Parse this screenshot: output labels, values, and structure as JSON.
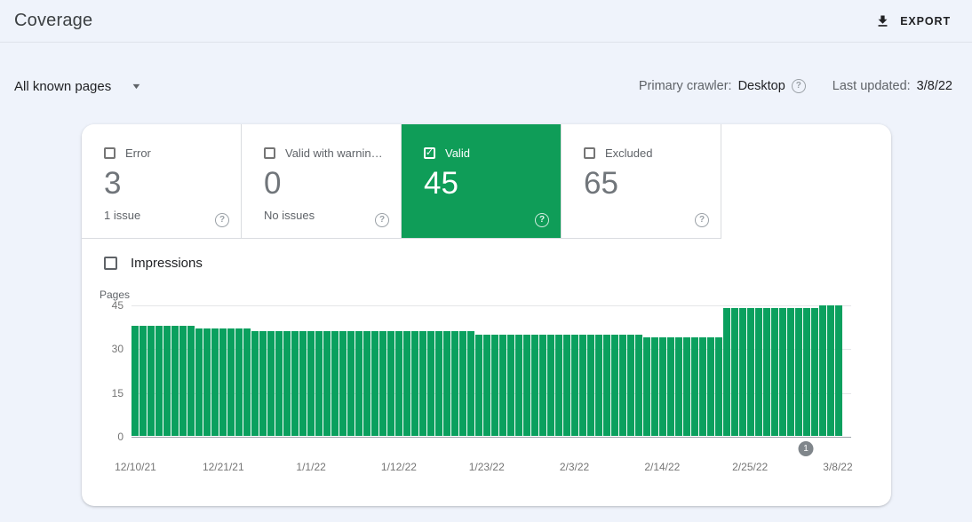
{
  "header": {
    "title": "Coverage",
    "export_label": "EXPORT"
  },
  "filter_bar": {
    "page_filter": "All known pages",
    "primary_crawler_label": "Primary crawler:",
    "primary_crawler_value": "Desktop",
    "last_updated_label": "Last updated:",
    "last_updated_value": "3/8/22"
  },
  "status_tiles": [
    {
      "label": "Error",
      "count": "3",
      "sub": "1 issue",
      "selected": false
    },
    {
      "label": "Valid with warnin…",
      "count": "0",
      "sub": "No issues",
      "selected": false
    },
    {
      "label": "Valid",
      "count": "45",
      "sub": "",
      "selected": true
    },
    {
      "label": "Excluded",
      "count": "65",
      "sub": "",
      "selected": false
    }
  ],
  "impressions_label": "Impressions",
  "icons": {
    "help": "?",
    "caret": "▼",
    "check": "✓"
  },
  "colors": {
    "selected_tile_green": "#0f9d58",
    "bar_green": "#0aa05e",
    "page_background": "#eff3fb",
    "marker_gray": "#80868b"
  },
  "chart_data": {
    "type": "bar",
    "title": "",
    "xlabel": "",
    "ylabel": "Pages",
    "ylim": [
      0,
      45
    ],
    "yticks": [
      45,
      30,
      15,
      0
    ],
    "grid": true,
    "x_unit": "day",
    "x_start": "12/10/21",
    "x_end": "3/8/22",
    "xtick_labels": [
      "12/10/21",
      "12/21/21",
      "1/1/22",
      "1/12/22",
      "1/23/22",
      "2/3/22",
      "2/14/22",
      "2/25/22",
      "3/8/22"
    ],
    "xtick_indices": [
      0,
      11,
      22,
      33,
      44,
      55,
      66,
      77,
      88
    ],
    "series": [
      {
        "name": "Valid pages",
        "values": [
          38,
          38,
          38,
          38,
          38,
          38,
          38,
          38,
          37,
          37,
          37,
          37,
          37,
          37,
          37,
          36,
          36,
          36,
          36,
          36,
          36,
          36,
          36,
          36,
          36,
          36,
          36,
          36,
          36,
          36,
          36,
          36,
          36,
          36,
          36,
          36,
          36,
          36,
          36,
          36,
          36,
          36,
          36,
          35,
          35,
          35,
          35,
          35,
          35,
          35,
          35,
          35,
          35,
          35,
          35,
          35,
          35,
          35,
          35,
          35,
          35,
          35,
          35,
          35,
          34,
          34,
          34,
          34,
          34,
          34,
          34,
          34,
          34,
          34,
          44,
          44,
          44,
          44,
          44,
          44,
          44,
          44,
          44,
          44,
          44,
          44,
          45,
          45,
          45
        ]
      }
    ],
    "marker": {
      "label": "1",
      "bar_index": 85
    }
  }
}
